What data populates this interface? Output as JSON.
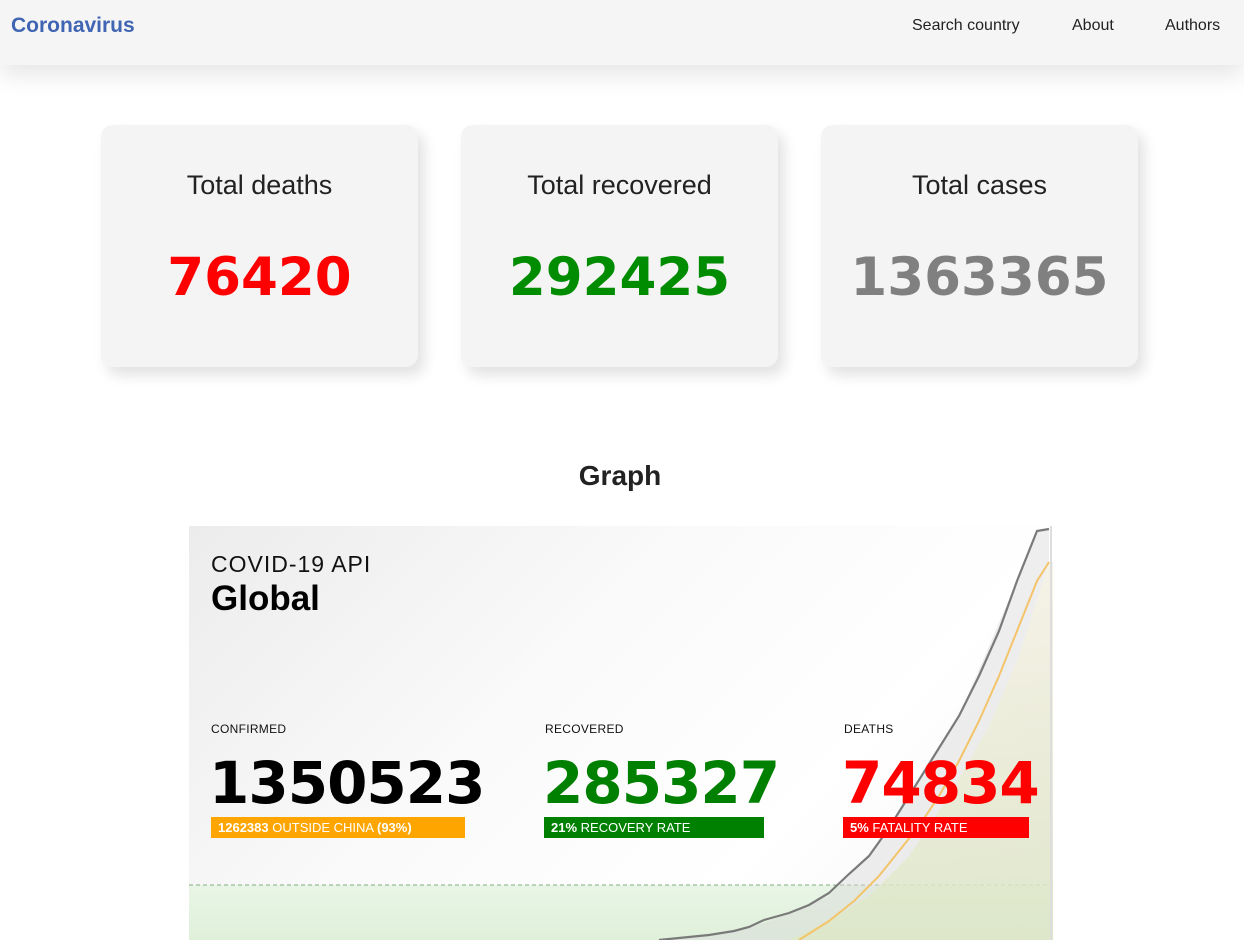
{
  "navbar": {
    "brand": "Coronavirus",
    "links": [
      "Search country",
      "About",
      "Authors"
    ]
  },
  "cards": [
    {
      "title": "Total deaths",
      "value": "76420",
      "color": "#ff0000"
    },
    {
      "title": "Total recovered",
      "value": "292425",
      "color": "#008c00"
    },
    {
      "title": "Total cases",
      "value": "1363365",
      "color": "#808080"
    }
  ],
  "graph_section": {
    "title": "Graph",
    "image": {
      "api_label": "COVID-19 API",
      "region": "Global",
      "confirmed": {
        "label": "CONFIRMED",
        "value": "1350523",
        "bar_strong": "1262383",
        "bar_text": "OUTSIDE CHINA",
        "bar_pct": "(93%)",
        "bar_color": "#ffa500"
      },
      "recovered": {
        "label": "RECOVERED",
        "value": "285327",
        "bar_strong": "21%",
        "bar_text": "RECOVERY RATE",
        "bar_color": "#008000"
      },
      "deaths": {
        "label": "DEATHS",
        "value": "74834",
        "bar_strong": "5%",
        "bar_text": "FATALITY RATE",
        "bar_color": "#ff0000"
      }
    }
  }
}
